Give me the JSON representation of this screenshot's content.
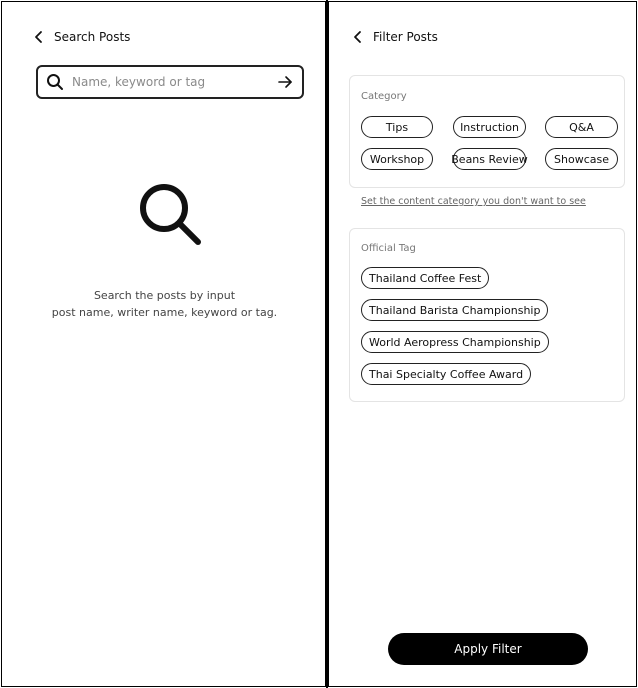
{
  "search_screen": {
    "title": "Search Posts",
    "search": {
      "placeholder": "Name, keyword or tag",
      "value": ""
    },
    "empty_line1": "Search the posts by input",
    "empty_line2": "post name, writer name, keyword or tag."
  },
  "filter_screen": {
    "title": "Filter Posts",
    "category": {
      "title": "Category",
      "chips": [
        "Tips",
        "Instruction",
        "Q&A",
        "Workshop",
        "Beans Review",
        "Showcase"
      ]
    },
    "set_link": "Set the content category you don't want to see",
    "official_tag": {
      "title": "Official Tag",
      "tags": [
        "Thailand Coffee Fest",
        "Thailand Barista Championship",
        "World Aeropress Championship",
        "Thai Specialty Coffee Award"
      ]
    },
    "apply_label": "Apply Filter"
  },
  "icons": {
    "back": "chevron-left-icon",
    "search": "search-icon",
    "arrow": "arrow-right-icon"
  }
}
